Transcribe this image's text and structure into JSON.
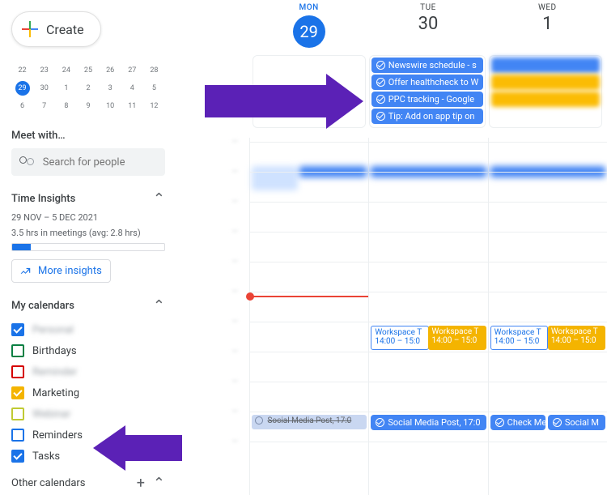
{
  "create_label": "Create",
  "mini_calendar": {
    "weeks": [
      [
        "22",
        "23",
        "24",
        "25",
        "26",
        "27",
        "28"
      ],
      [
        "29",
        "30",
        "1",
        "2",
        "3",
        "4",
        "5"
      ],
      [
        "6",
        "7",
        "8",
        "9",
        "10",
        "11",
        "12"
      ]
    ],
    "today": "29"
  },
  "meet_with_label": "Meet with…",
  "search_people_placeholder": "Search for people",
  "time_insights": {
    "heading": "Time Insights",
    "range": "29 NOV – 5 DEC 2021",
    "summary": "3.5 hrs in meetings (avg: 2.8 hrs)",
    "more_label": "More insights"
  },
  "my_calendars_label": "My calendars",
  "my_calendars": [
    {
      "label": "Personal",
      "color": "#1a73e8",
      "checked": true,
      "blurred": true
    },
    {
      "label": "Birthdays",
      "color": "#0b8043",
      "checked": false,
      "blurred": false
    },
    {
      "label": "Reminder",
      "color": "#d50000",
      "checked": false,
      "blurred": true
    },
    {
      "label": "Marketing",
      "color": "#f4b400",
      "checked": true,
      "blurred": false
    },
    {
      "label": "Webinar",
      "color": "#c0ca33",
      "checked": false,
      "blurred": true
    },
    {
      "label": "Reminders",
      "color": "#1a73e8",
      "checked": false,
      "blurred": false
    },
    {
      "label": "Tasks",
      "color": "#1a73e8",
      "checked": true,
      "blurred": false
    }
  ],
  "other_calendars_label": "Other calendars",
  "days": [
    {
      "dow": "MON",
      "num": "29",
      "selected": true
    },
    {
      "dow": "TUE",
      "num": "30",
      "selected": false
    },
    {
      "dow": "WED",
      "num": "1",
      "selected": false
    }
  ],
  "tue_tasks": [
    "Newswire schedule - s",
    "Offer healthcheck to W",
    "PPC tracking - Google",
    "Tip: Add on app tip on"
  ],
  "workspace_event": {
    "title": "Workspace T",
    "time": "14:00 – 15:0"
  },
  "social_posts": {
    "mon": "Social Media Post, 17:0",
    "tue": "Social Media Post, 17:0",
    "wed_a": "Check Me",
    "wed_b": "Social M"
  }
}
